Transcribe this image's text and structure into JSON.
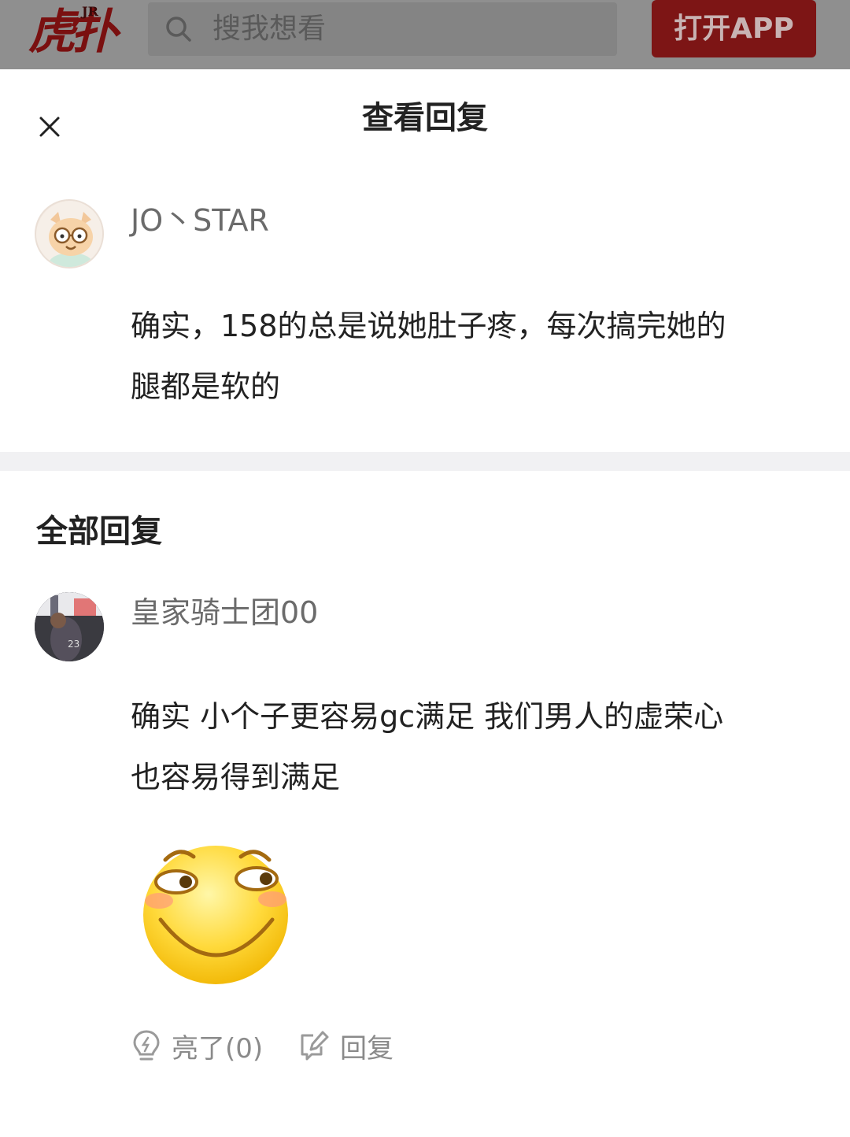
{
  "header": {
    "logo_text": "虎扑",
    "logo_badge": "JR",
    "search_placeholder": "搜我想看",
    "open_app_label": "打开APP"
  },
  "sheet": {
    "title": "查看回复",
    "close_icon": "close-icon"
  },
  "original_comment": {
    "username": "JO丶STAR",
    "text_line1": "确实，158的总是说她肚子疼，每次搞完她的",
    "text_line2": "腿都是软的"
  },
  "all_replies": {
    "section_title": "全部回复",
    "replies": [
      {
        "username": "皇家骑士团00",
        "text_line1": "确实 小个子更容易gc满足 我们男人的虚荣心",
        "text_line2": "也容易得到满足",
        "sticker": "grinning-emoji",
        "like_label": "亮了(0)",
        "reply_label": "回复"
      }
    ]
  },
  "colors": {
    "brand_red": "#7d1515",
    "overlay_gray": "#8f8f8f",
    "divider": "#f1f1f3",
    "muted_text": "#8a8a8a"
  }
}
